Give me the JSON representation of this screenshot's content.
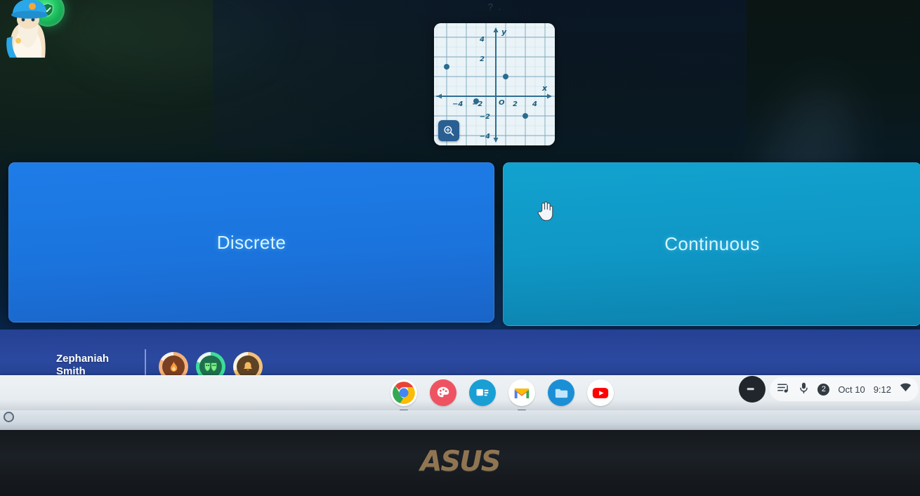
{
  "app": {
    "question_text": "? .",
    "top_badge_icon": "shield-check-icon"
  },
  "graph": {
    "zoom_button_icon": "magnify-plus-icon",
    "axis_label_x": "x",
    "axis_label_y": "y",
    "origin_label": "O",
    "x_ticks": [
      "-4",
      "-2",
      "2",
      "4"
    ],
    "y_ticks": [
      "4",
      "2",
      "-2",
      "-4"
    ]
  },
  "chart_data": {
    "type": "scatter",
    "title": "",
    "xlabel": "x",
    "ylabel": "y",
    "xlim": [
      -6,
      6
    ],
    "ylim": [
      -6,
      6
    ],
    "grid": true,
    "legend": "none",
    "points": [
      {
        "x": -5,
        "y": 3
      },
      {
        "x": 1,
        "y": 2
      },
      {
        "x": -2,
        "y": -0.5
      },
      {
        "x": 3,
        "y": -2
      }
    ]
  },
  "answers": [
    {
      "id": "discrete",
      "label": "Discrete",
      "color": "#1b74dd"
    },
    {
      "id": "continuous",
      "label": "Continuous",
      "color": "#0f96c4"
    }
  ],
  "player": {
    "first_name": "Zephaniah",
    "last_name": "Smith",
    "avatar_icon": "wizard-avatar",
    "badges": [
      {
        "id": "fire",
        "icon": "flame-icon",
        "ring_color": "#f3b07a"
      },
      {
        "id": "mask",
        "icon": "mask-icon",
        "ring_color": "#3ddc9a"
      },
      {
        "id": "bell",
        "icon": "bell-icon",
        "ring_color": "#f2c27b"
      }
    ]
  },
  "shelf": {
    "apps": [
      {
        "id": "chrome",
        "icon": "chrome-icon",
        "active": true
      },
      {
        "id": "canvas",
        "icon": "palette-icon",
        "active": false
      },
      {
        "id": "slides",
        "icon": "presentation-icon",
        "active": false
      },
      {
        "id": "gmail",
        "icon": "gmail-icon",
        "active": true
      },
      {
        "id": "files",
        "icon": "folder-icon",
        "active": false
      },
      {
        "id": "youtube",
        "icon": "youtube-icon",
        "active": false
      }
    ]
  },
  "tray": {
    "avatar_icon": "user-avatar-icon",
    "music_icon": "playlist-icon",
    "mic_icon": "microphone-icon",
    "notification_count": "2",
    "date": "Oct 10",
    "time": "9:12",
    "wifi_icon": "wifi-icon"
  },
  "device": {
    "brand": "ASUS"
  }
}
